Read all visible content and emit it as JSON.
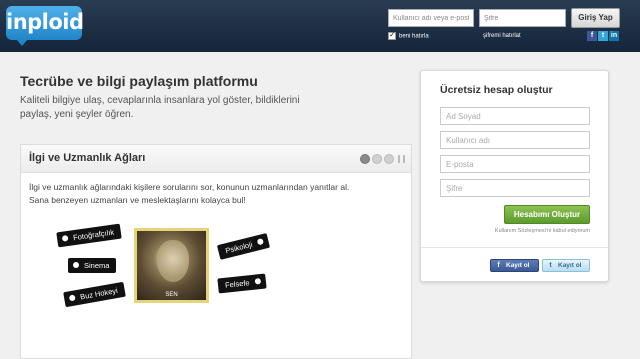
{
  "header": {
    "logo_text": "inploid",
    "username_placeholder": "Kullanıcı adı veya e-posta",
    "password_placeholder": "Şifre",
    "login_label": "Giriş Yap",
    "remember_label": "beni hatırla",
    "forgot_label": "şifremi hatırlat",
    "social": [
      "f",
      "t",
      "in"
    ]
  },
  "hero": {
    "headline": "Tecrübe ve bilgi paylaşım platformu",
    "subtext": "Kaliteli bilgiye ulaş, cevaplarınla insanlara yol göster, bildiklerini paylaş, yeni şeyler öğren."
  },
  "panel": {
    "title": "İlgi ve Uzmanlık Ağları",
    "text": "İlgi ve uzmanlık ağlarındaki kişilere sorularını sor, konunun uzmanlarından yanıtlar al. Sana benzeyen uzmanları ve meslektaşlarını kolayca bul!",
    "tags": [
      "Fotoğrafçılık",
      "Sinema",
      "Buz Hokeyi",
      "Psikoloji",
      "Felsefe"
    ],
    "portrait_label": "SEN"
  },
  "signup": {
    "title": "Ücretsiz hesap oluştur",
    "fields": [
      "Ad Soyad",
      "Kullanıcı adı",
      "E-posta",
      "Şifre"
    ],
    "button": "Hesabımı Oluştur",
    "terms": "Kullanım Sözleşmesi'ni kabul ediyorum",
    "facebook": "Kayıt ol",
    "twitter": "Kayıt ol"
  },
  "colors": {
    "header": "#1c2d42",
    "accent": "#2186c9",
    "create_button": "#6aa834",
    "facebook": "#3b5998",
    "twitter": "#b9ddf2"
  }
}
